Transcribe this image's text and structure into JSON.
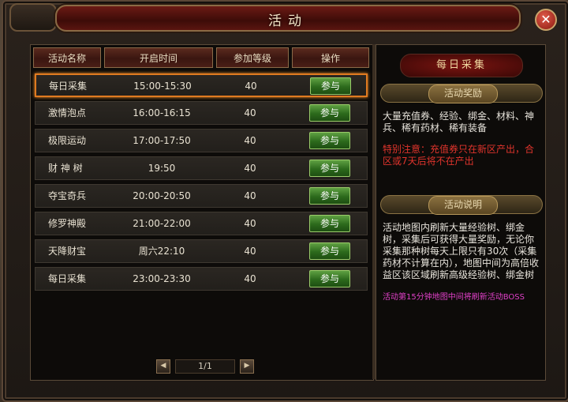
{
  "window": {
    "title": "活动",
    "close_label": "✕"
  },
  "table": {
    "headers": [
      "活动名称",
      "开启时间",
      "参加等级",
      "操作"
    ],
    "rows": [
      {
        "name": "每日采集",
        "time": "15:00-15:30",
        "level": "40",
        "action": "参与",
        "selected": true
      },
      {
        "name": "激情泡点",
        "time": "16:00-16:15",
        "level": "40",
        "action": "参与"
      },
      {
        "name": "极限运动",
        "time": "17:00-17:50",
        "level": "40",
        "action": "参与"
      },
      {
        "name": "财 神 树",
        "time": "19:50",
        "level": "40",
        "action": "参与"
      },
      {
        "name": "夺宝奇兵",
        "time": "20:00-20:50",
        "level": "40",
        "action": "参与"
      },
      {
        "name": "修罗神殿",
        "time": "21:00-22:00",
        "level": "40",
        "action": "参与"
      },
      {
        "name": "天降财宝",
        "time": "周六22:10",
        "level": "40",
        "action": "参与"
      },
      {
        "name": "每日采集",
        "time": "23:00-23:30",
        "level": "40",
        "action": "参与"
      }
    ]
  },
  "pager": {
    "prev_icon": "◀",
    "page": "1/1",
    "next_icon": "▶"
  },
  "detail": {
    "title": "每日采集",
    "reward_header": "活动奖励",
    "reward_text": "大量充值券、经验、绑金、材料、神兵、稀有药材、稀有装备",
    "reward_note": "特别注意：充值券只在新区产出，合区或7天后将不在产出",
    "desc_header": "活动说明",
    "desc_text": "活动地图内刷新大量经验树、绑金树，采集后可获得大量奖励，无论你采集那种树每天上限只有30次（采集药材不计算在内），地图中间为高倍收益区该区域刷新高级经验树、绑金树",
    "desc_note": "活动第15分钟地图中间将刷新活动BOSS"
  },
  "colors": {
    "accent": "#e07a20",
    "button": "#2c6a1c",
    "warning": "#e0342c",
    "note": "#e040c8"
  }
}
